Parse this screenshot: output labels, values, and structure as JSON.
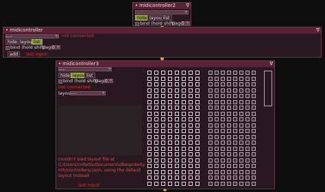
{
  "mc2": {
    "title": "midicontroller2",
    "pin": "∇",
    "hide_label": "hide",
    "layout_label": "layout",
    "list_label": "list",
    "bind_label": "bind (hold shift)",
    "page_label": "page",
    "page_value": "0"
  },
  "mc1": {
    "title": "midicontroller",
    "pin": "∇",
    "dropdown_value": "----",
    "status": "not connected",
    "hide_label": "hide",
    "layout_label": "layout",
    "list_label": "list",
    "bind_label": "bind (hold shift)",
    "page_label": "page",
    "page_value": "0",
    "add_label": "add",
    "last_input_label": "last input:"
  },
  "mc3": {
    "title": "midicontroller3",
    "pin": "∇",
    "dropdown_value": "----",
    "hide_label": "hide",
    "layout_label": "layout",
    "list_label": "list",
    "bind_label": "bind (hold shift)",
    "page_label": "page",
    "page_value": "0",
    "status": "not connected",
    "layout_dropdown_label": "layout",
    "layout_dropdown_value": "----",
    "error_lines": [
      "couldn't load layout file at",
      "C:/Users/collette/Documents/BespokeSy",
      "nth/controllers/.json, using the default",
      "layout instead"
    ],
    "last_input_label": "last input:"
  },
  "colors": {
    "title_bg": "#5a2236",
    "module_bg": "#2a1820",
    "active_toggle": "#8a9a40",
    "status_red": "#d63a3a",
    "cable": "#e0a25a"
  }
}
